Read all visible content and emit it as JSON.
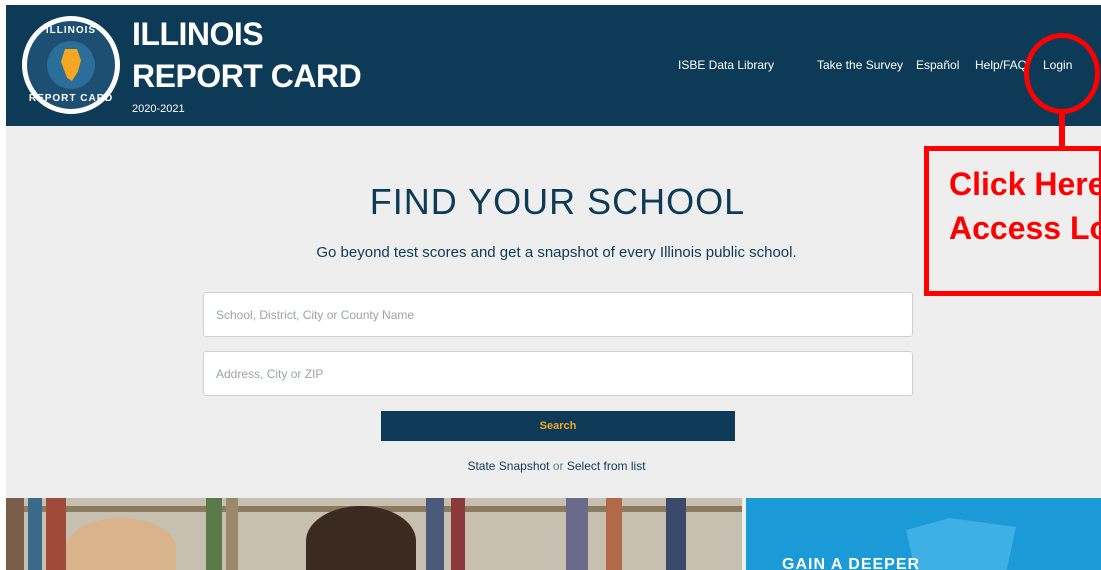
{
  "header": {
    "brand_line1": "ILLINOIS",
    "brand_line2": "REPORT CARD",
    "year": "2020-2021",
    "logo_top": "ILLINOIS",
    "logo_bottom": "REPORT CARD",
    "nav": [
      {
        "label": "ISBE Data Library"
      },
      {
        "label": "Take the Survey"
      },
      {
        "label": "Español"
      },
      {
        "label": "Help/FAQ"
      },
      {
        "label": "Login"
      }
    ]
  },
  "annotation": {
    "line1": "Click Here to",
    "line2": "Access Login",
    "color": "#ff0000"
  },
  "hero": {
    "title": "FIND YOUR SCHOOL",
    "subtitle": "Go beyond test scores and get a snapshot of every Illinois public school."
  },
  "search": {
    "name_placeholder": "School, District, City or County Name",
    "name_value": "",
    "address_placeholder": "Address, City or ZIP",
    "address_value": "",
    "button_label": "Search"
  },
  "links": {
    "snapshot": "State Snapshot",
    "or": "or",
    "list": "Select from list"
  },
  "promo": {
    "text": "GAIN A DEEPER"
  },
  "colors": {
    "header_bg": "#0d3b57",
    "accent": "#f5a623",
    "page_bg": "#eeeeee",
    "promo_bg": "#1a9ad6"
  }
}
